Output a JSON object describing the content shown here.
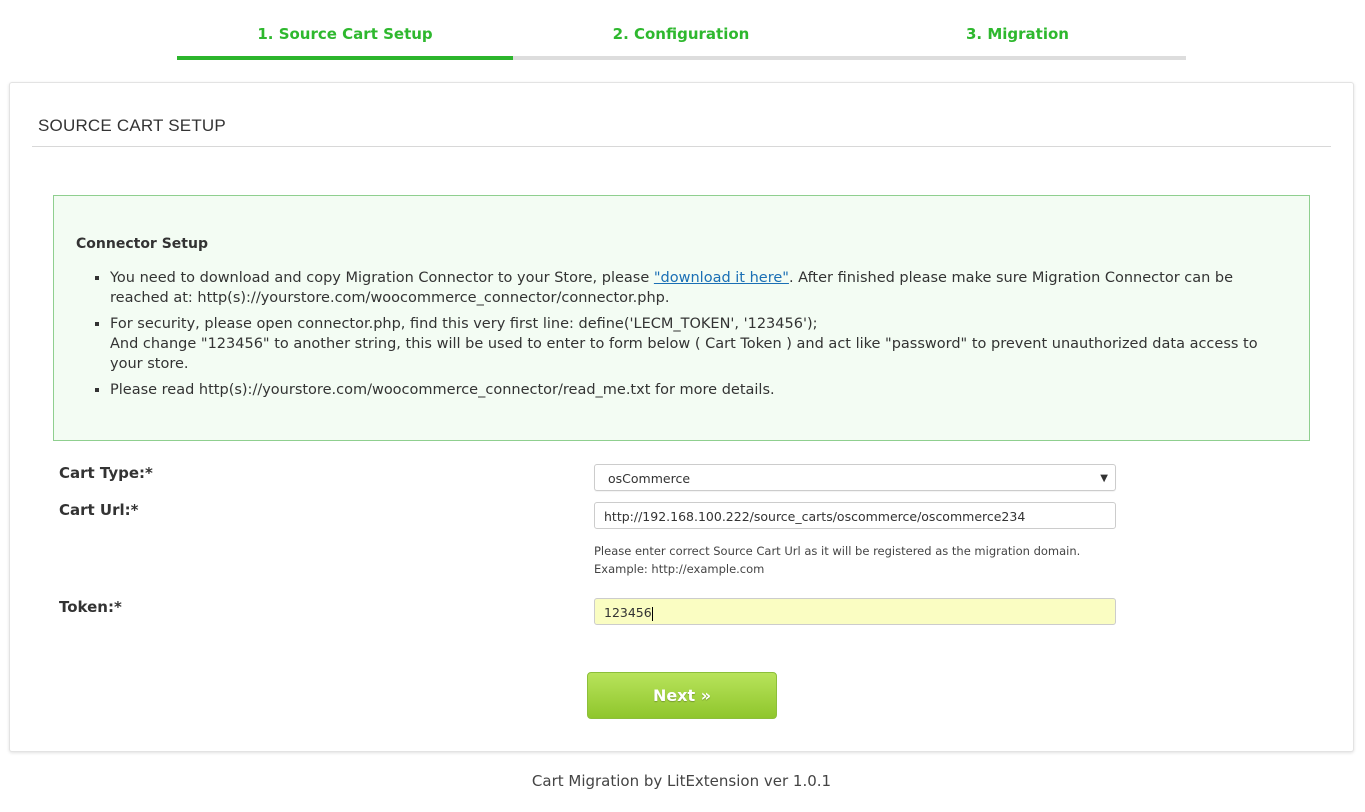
{
  "steps": [
    {
      "label": "1. Source Cart Setup",
      "active": true
    },
    {
      "label": "2. Configuration",
      "active": false
    },
    {
      "label": "3. Migration",
      "active": false
    }
  ],
  "panel": {
    "title": "SOURCE CART SETUP",
    "connector": {
      "title": "Connector Setup",
      "item1_pre": "You need to download and copy Migration Connector to your Store, please ",
      "item1_link": "\"download it here\"",
      "item1_post": ". After finished please make sure Migration Connector can be reached at: http(s)://yourstore.com/woocommerce_connector/connector.php.",
      "item2_line1": "For security, please open connector.php, find this very first line: define('LECM_TOKEN', '123456');",
      "item2_line2": "And change \"123456\" to another string, this will be used to enter to form below ( Cart Token ) and act like \"password\" to prevent unauthorized data access to your store.",
      "item3": "Please read http(s)://yourstore.com/woocommerce_connector/read_me.txt for more details."
    },
    "form": {
      "cart_type_label": "Cart Type:*",
      "cart_type_value": "osCommerce",
      "cart_url_label": "Cart Url:*",
      "cart_url_value": "http://192.168.100.222/source_carts/oscommerce/oscommerce234",
      "help_line1": "Please enter correct Source Cart Url as it will be registered as the migration domain.",
      "help_line2": "Example: http://example.com",
      "token_label": "Token:*",
      "token_value": "123456"
    },
    "next_button": "Next »"
  },
  "footer": "Cart Migration by LitExtension ver 1.0.1",
  "colors": {
    "accent_green": "#2cb52c",
    "info_bg": "#f3fcf3",
    "token_bg": "#fafdc2",
    "button_green": "#a0d244"
  }
}
